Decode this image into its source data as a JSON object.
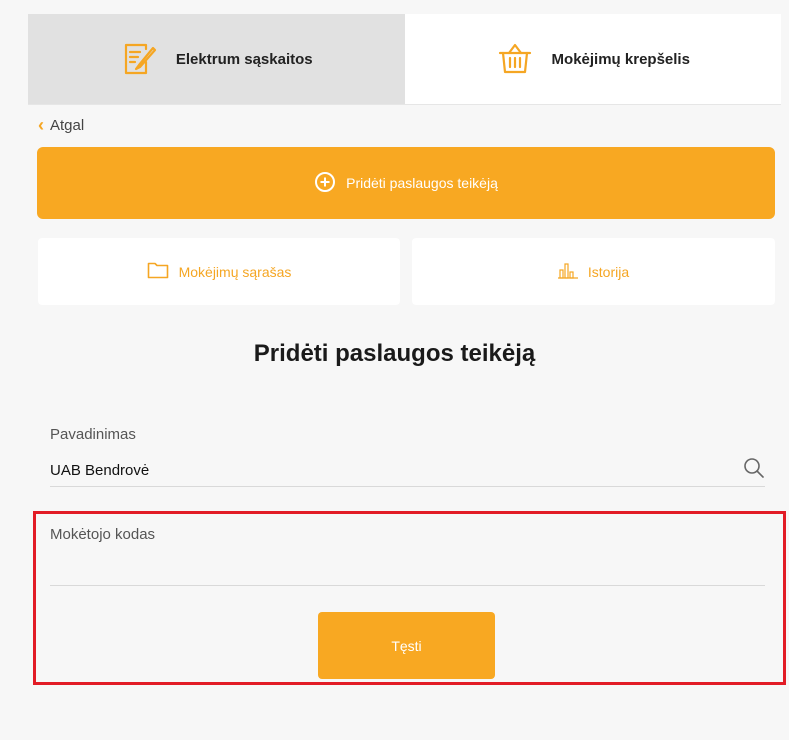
{
  "tabs": [
    {
      "label": "Elektrum sąskaitos",
      "icon": "invoice-edit-icon",
      "active": true
    },
    {
      "label": "Mokėjimų krepšelis",
      "icon": "basket-icon",
      "active": false
    }
  ],
  "back": {
    "label": "Atgal",
    "icon": "chevron-left-icon"
  },
  "add_provider_button": {
    "label": "Pridėti paslaugos teikėją",
    "icon": "plus-circle-icon"
  },
  "cards": [
    {
      "label": "Mokėjimų sąrašas",
      "icon": "folder-icon"
    },
    {
      "label": "Istorija",
      "icon": "bar-chart-icon"
    }
  ],
  "page_title": "Pridėti paslaugos teikėją",
  "form": {
    "name_label": "Pavadinimas",
    "name_value": "UAB Bendrovė",
    "payer_code_label": "Mokėtojo kodas",
    "payer_code_value": "",
    "continue_label": "Tęsti"
  },
  "colors": {
    "accent": "#f8a822",
    "highlight": "#e21c26",
    "active_tab": "#e1e1e1"
  }
}
